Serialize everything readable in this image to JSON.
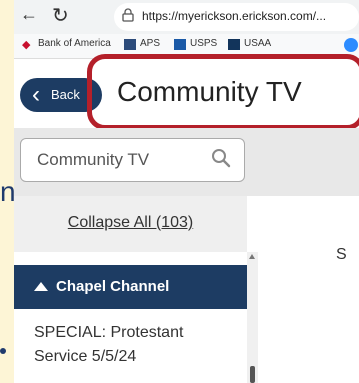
{
  "browser": {
    "url": "https://myerickson.erickson.com/...",
    "nav_back_glyph": "←",
    "nav_reload_glyph": "↻",
    "bookmarks": [
      {
        "label": "Bank of America",
        "icon": "bank-of-america-icon",
        "color": "#c8102e"
      },
      {
        "label": "APS",
        "icon": "aps-icon",
        "color": "#2c4b7a"
      },
      {
        "label": "USPS",
        "icon": "usps-icon",
        "color": "#1b5aa7"
      },
      {
        "label": "USAA",
        "icon": "usaa-icon",
        "color": "#12345b"
      }
    ]
  },
  "left_strip": {
    "letter": "n"
  },
  "header": {
    "back_label": "Back",
    "back_glyph": "‹",
    "title": "Community TV"
  },
  "search": {
    "value": "Community TV",
    "placeholder": "Community TV"
  },
  "sidebar": {
    "collapse_all": "Collapse All (103)",
    "channel": {
      "name": "Chapel Channel"
    },
    "items": [
      {
        "line1": "SPECIAL: Protestant",
        "line2": "Service 5/5/24"
      }
    ]
  },
  "main": {
    "partial_text": "S"
  },
  "colors": {
    "accent": "#1d3c63",
    "highlight": "#b4202a",
    "frame": "#fdf5d6"
  }
}
